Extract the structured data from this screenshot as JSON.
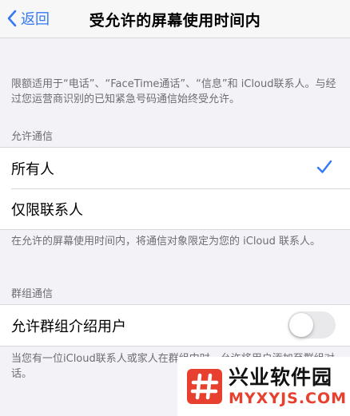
{
  "navbar": {
    "back_label": "返回",
    "title": "受允许的屏幕使用时间内"
  },
  "top_note": "限额适用于“电话”、“FaceTime通话”、“信息”和 iCloud联系人。与经过您运营商识别的已知紧急号码通信始终受允许。",
  "allowed_communication": {
    "header": "允许通信",
    "options": [
      {
        "label": "所有人",
        "selected": true
      },
      {
        "label": "仅限联系人",
        "selected": false
      }
    ],
    "footer": "在允许的屏幕使用时间内，将通信对象限定为您的 iCloud 联系人。"
  },
  "group_communication": {
    "header": "群组通信",
    "toggle_label": "允许群组介绍用户",
    "toggle_on": false,
    "footer": "当您有一位iCloud联系人或家人在群组中时，允许将用户添加至群组对话。"
  },
  "watermark": {
    "name": "兴业软件园",
    "domain": "MYXYJS.COM",
    "color": "#e8402e"
  },
  "colors": {
    "accent": "#3478f6",
    "background": "#f2f2f7"
  }
}
